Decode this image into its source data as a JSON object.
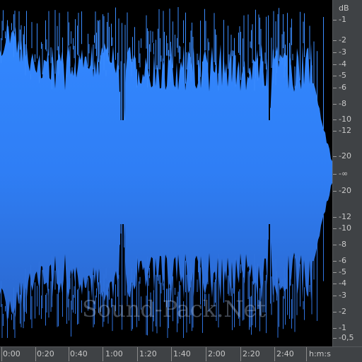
{
  "app": {
    "watermark": "Sound-Pack.Net"
  },
  "colors": {
    "background": "#000000",
    "wave_top": "#2f82ff",
    "wave_bottom": "#2a6fd8",
    "ruler_bg": "#3f4245",
    "ruler_text": "#c8c8c8"
  },
  "db_scale": {
    "unit": "dB",
    "labels": [
      "-1",
      "-2",
      "-3",
      "-4",
      "-5",
      "-6",
      "-8",
      "-10",
      "-12",
      "-20",
      "-∞",
      "-20",
      "-12",
      "-10",
      "-8",
      "-6",
      "-5",
      "-4",
      "-3",
      "-2",
      "-1",
      "-0,5"
    ]
  },
  "time_scale": {
    "unit": "h:m:s",
    "labels": [
      "0:00",
      "0:20",
      "0:40",
      "1:00",
      "1:20",
      "1:40",
      "2:00",
      "2:20",
      "2:40"
    ]
  }
}
